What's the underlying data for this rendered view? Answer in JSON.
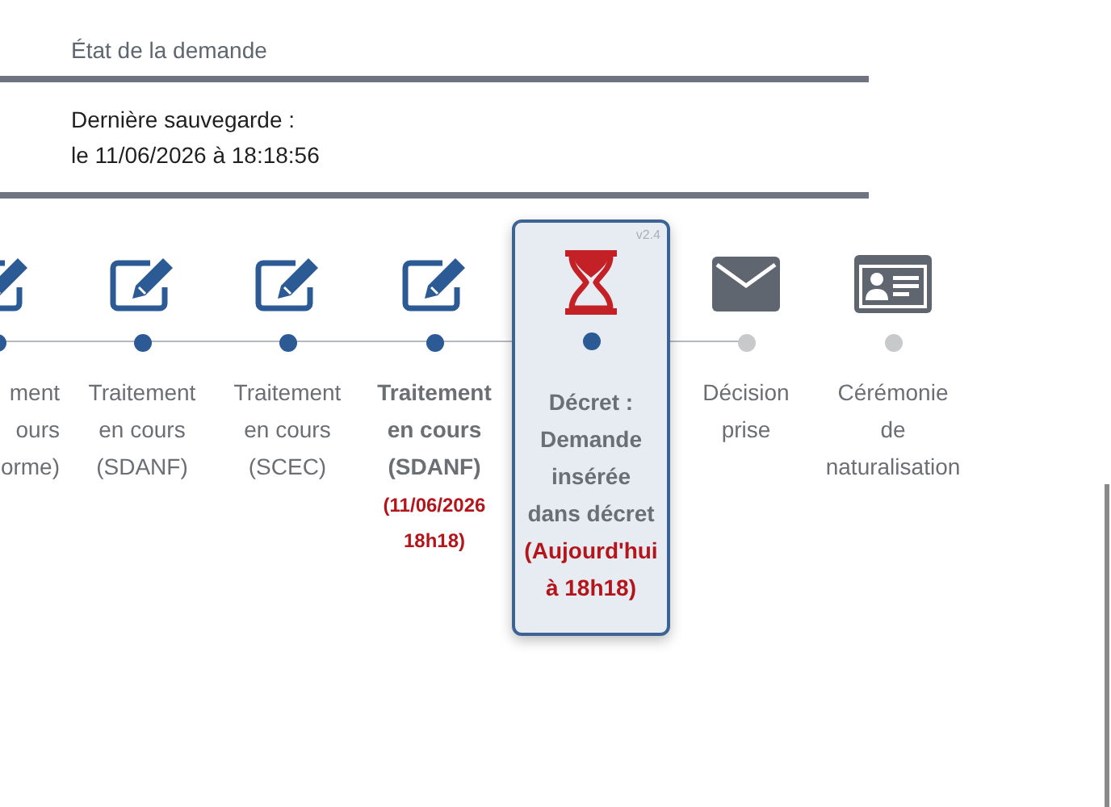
{
  "section_title": "État de la demande",
  "last_save": {
    "label": "Dernière sauvegarde :",
    "value": "le 11/06/2026 à 18:18:56"
  },
  "timeline": {
    "steps": [
      {
        "kind": "edit",
        "done": true,
        "selected": false,
        "emphasis": false,
        "label_lines": [
          "ment",
          "ours",
          "orme)"
        ]
      },
      {
        "kind": "edit",
        "done": true,
        "selected": false,
        "emphasis": false,
        "label_lines": [
          "Traitement",
          "en cours",
          "(SDANF)"
        ]
      },
      {
        "kind": "edit",
        "done": true,
        "selected": false,
        "emphasis": false,
        "label_lines": [
          "Traitement",
          "en cours",
          "(SCEC)"
        ]
      },
      {
        "kind": "edit",
        "done": true,
        "selected": false,
        "emphasis": true,
        "label_lines": [
          "Traitement",
          "en cours",
          "(SDANF)"
        ],
        "date_lines": [
          "(11/06/2026",
          "18h18)"
        ]
      },
      {
        "kind": "hourglass",
        "done": true,
        "selected": true,
        "emphasis": true,
        "version": "v2.4",
        "label_lines": [
          "Décret :",
          "Demande",
          "insérée",
          "dans décret"
        ],
        "date_lines": [
          "(Aujourd'hui",
          "à 18h18)"
        ]
      },
      {
        "kind": "envelope",
        "done": false,
        "selected": false,
        "emphasis": false,
        "label_lines": [
          "Décision",
          "prise"
        ]
      },
      {
        "kind": "idcard",
        "done": false,
        "selected": false,
        "emphasis": false,
        "label_lines": [
          "Cérémonie",
          "de",
          "naturalisation"
        ]
      }
    ]
  }
}
